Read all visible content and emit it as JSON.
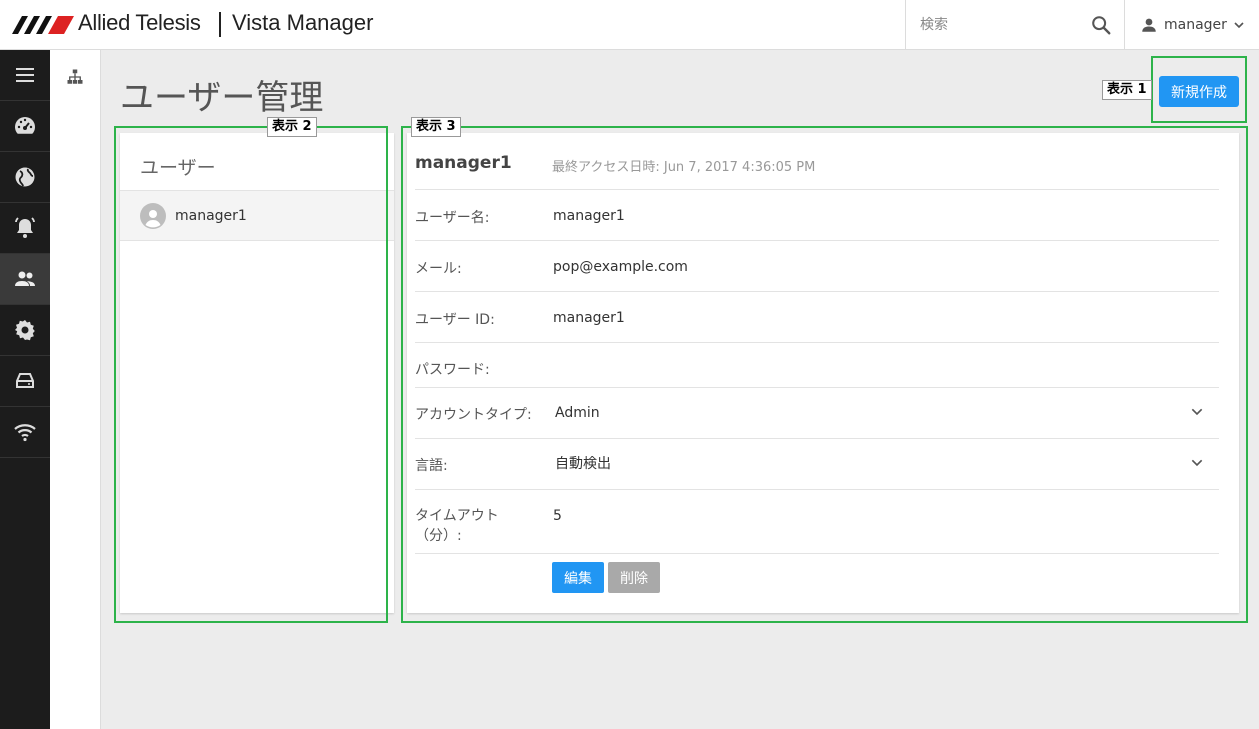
{
  "header": {
    "brand": "Allied Telesis",
    "app_name": "Vista Manager",
    "search_placeholder": "検索",
    "user_menu_label": "manager"
  },
  "sidebar": {
    "items": [
      {
        "name": "menu",
        "icon": "hamburger-icon"
      },
      {
        "name": "dashboard",
        "icon": "dashboard-icon"
      },
      {
        "name": "network",
        "icon": "globe-icon"
      },
      {
        "name": "alarms",
        "icon": "bell-icon"
      },
      {
        "name": "users",
        "icon": "people-icon",
        "active": true
      },
      {
        "name": "settings",
        "icon": "gear-icon"
      },
      {
        "name": "storage",
        "icon": "storage-icon"
      },
      {
        "name": "wireless",
        "icon": "wifi-icon"
      }
    ]
  },
  "page": {
    "title": "ユーザー管理",
    "new_button": "新規作成"
  },
  "users_panel": {
    "title": "ユーザー",
    "users": [
      "manager1"
    ]
  },
  "detail": {
    "username": "manager1",
    "last_access": "最終アクセス日時: Jun 7, 2017 4:36:05 PM",
    "fields": {
      "username_label": "ユーザー名:",
      "username_value": "manager1",
      "email_label": "メール:",
      "email_value": "pop@example.com",
      "userid_label": "ユーザー ID:",
      "userid_value": "manager1",
      "password_label": "パスワード:",
      "account_type_label": "アカウントタイプ:",
      "account_type_value": "Admin",
      "language_label": "言語:",
      "language_value": "自動検出",
      "timeout_label_line1": "タイムアウト",
      "timeout_label_line2": "（分）:",
      "timeout_value": "5"
    },
    "edit_button": "編集",
    "delete_button": "削除"
  },
  "annotations": {
    "tag1": "表示 1",
    "tag2": "表示 2",
    "tag3": "表示 3"
  },
  "colors": {
    "accent": "#2196f3",
    "annotation": "#2db34a",
    "sidebar": "#1c1c1c"
  }
}
